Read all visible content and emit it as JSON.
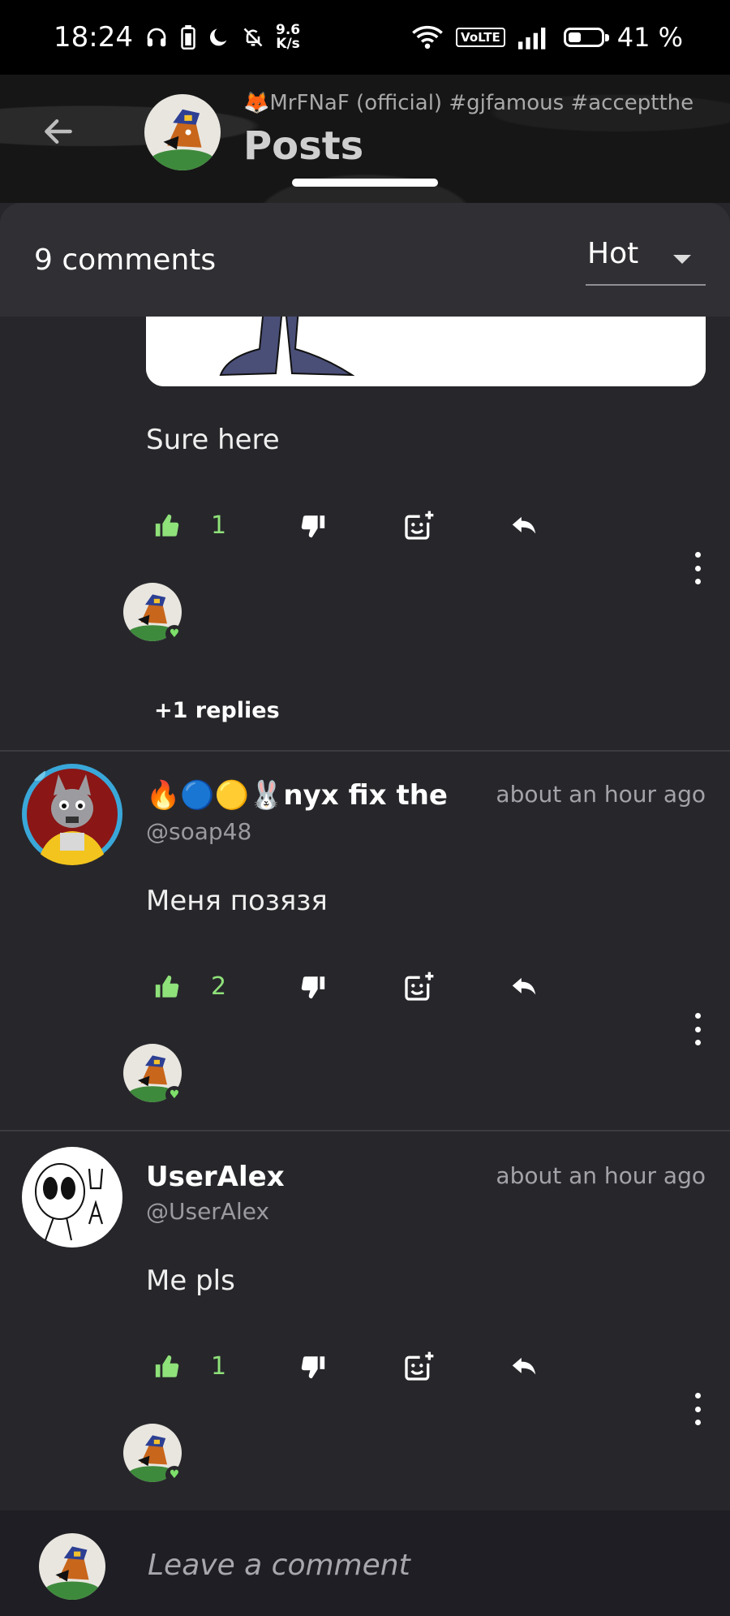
{
  "status_bar": {
    "time": "18:24",
    "net_speed_value": "9.6",
    "net_speed_unit": "K/s",
    "volte": "VoLTE",
    "battery_label": "41 %",
    "battery_level": 0.41,
    "icons": [
      "headphones-icon",
      "battery-saver-icon",
      "moon-icon",
      "bell-off-icon",
      "wifi-icon",
      "volte-icon",
      "signal-icon",
      "battery-icon"
    ]
  },
  "header": {
    "community": "🦊MrFNaF (official) #gjfamous #acceptthe",
    "title": "Posts"
  },
  "comments_header": {
    "count_label": "9 comments",
    "sort_value": "Hot"
  },
  "comments": [
    {
      "text": "Sure here",
      "likes": "1",
      "replies_label": "+1 replies"
    },
    {
      "author": "🔥🔵🟡🐰nyx fix the",
      "handle": "@soap48",
      "time": "about an hour ago",
      "text": "Меня позязя",
      "likes": "2"
    },
    {
      "author": "UserAlex",
      "handle": "@UserAlex",
      "time": "about an hour ago",
      "text": "Me pls",
      "likes": "1"
    }
  ],
  "footer": {
    "placeholder": "Leave a comment"
  },
  "colors": {
    "background": "#27272b",
    "accent_like": "#8fe17a",
    "sheet": "#303034",
    "footer": "#1e1e24"
  }
}
